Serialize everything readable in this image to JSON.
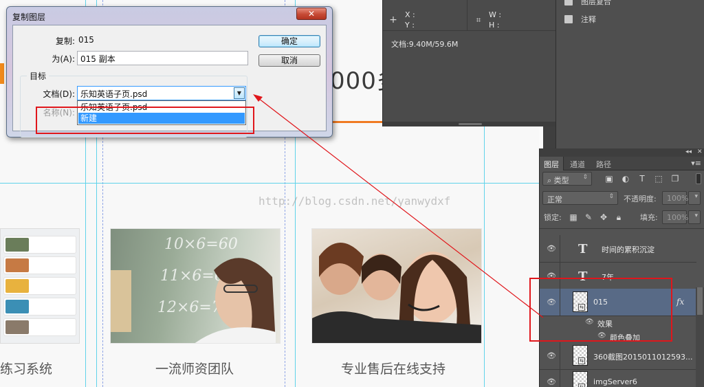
{
  "webpage": {
    "headline": "000多",
    "watermark": "http://blog.csdn.net/yanwydxf",
    "captions": [
      "练习系统",
      "一流师资团队",
      "专业售后在线支持"
    ],
    "chalk_formulas": [
      "10×6=60",
      "11×6=66",
      "12×6=77"
    ]
  },
  "info_panel": {
    "x_label": "X :",
    "y_label": "Y :",
    "w_label": "W :",
    "h_label": "H :",
    "doc_size": "文档:9.40M/59.6M"
  },
  "side_panel": {
    "items": [
      {
        "label": "图层复合",
        "icon": "layer-comps-icon"
      },
      {
        "label": "注释",
        "icon": "notes-icon"
      }
    ]
  },
  "layers_panel": {
    "tabs": [
      "图层",
      "通道",
      "路径"
    ],
    "filter_kind": "类型",
    "blend_mode": "正常",
    "opacity_label": "不透明度:",
    "opacity_value": "100%",
    "lock_label": "锁定:",
    "fill_label": "填充:",
    "fill_value": "100%",
    "layers": [
      {
        "name": "时间的累积沉淀",
        "kind": "text",
        "selected": false
      },
      {
        "name": "7年",
        "kind": "text",
        "selected": false
      },
      {
        "name": "015",
        "kind": "smart",
        "selected": true,
        "fx": "fx"
      },
      {
        "name": "360截图2015011012593...",
        "kind": "smart",
        "selected": false
      },
      {
        "name": "imgServer6",
        "kind": "smart",
        "selected": false
      }
    ],
    "effects_label": "效果",
    "effect_item": "颜色叠加"
  },
  "dialog": {
    "title": "复制图层",
    "close_glyph": "✕",
    "copy_label": "复制:",
    "copy_value": "015",
    "as_label": "为(A):",
    "as_value": "015 副本",
    "ok_label": "确定",
    "cancel_label": "取消",
    "group_title": "目标",
    "document_label": "文档(D):",
    "document_value": "乐知英语子页.psd",
    "name_label": "名称(N):",
    "dropdown_options": [
      "乐知英语子页.psd",
      "新建"
    ],
    "highlighted_option": "新建"
  },
  "colors": {
    "ps_panel": "#535353",
    "selected_layer": "#586a86",
    "annotation_red": "#e0161b",
    "accent_orange": "#f07a22",
    "guide_cyan": "#5fd3ea"
  }
}
